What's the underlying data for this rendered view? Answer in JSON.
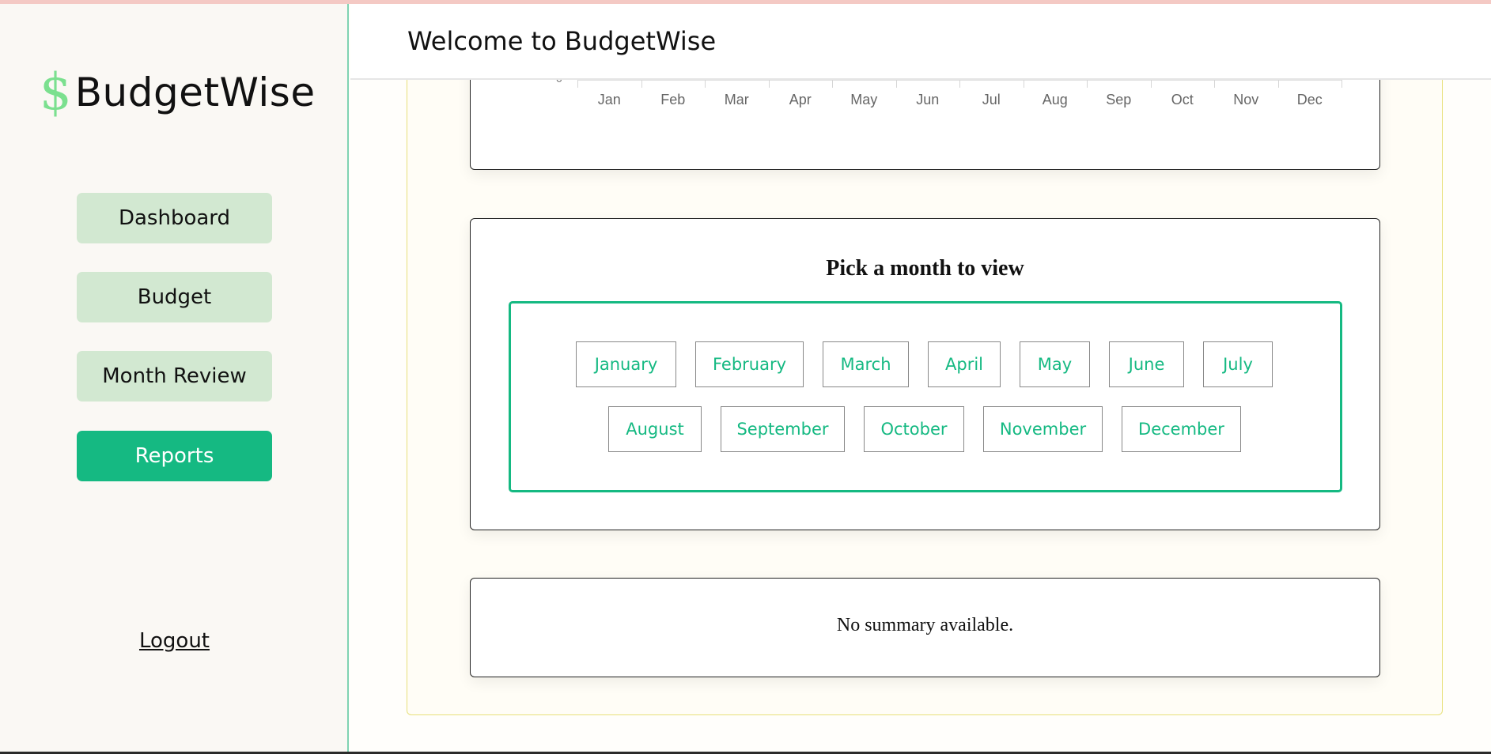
{
  "app": {
    "brand": "BudgetWise",
    "logo_icon": "dollar-sign-icon",
    "accent_color": "#15b982",
    "nav_inactive_color": "#d2e8d1"
  },
  "header": {
    "title": "Welcome to BudgetWise"
  },
  "sidebar": {
    "items": [
      {
        "label": "Dashboard",
        "active": false
      },
      {
        "label": "Budget",
        "active": false
      },
      {
        "label": "Month Review",
        "active": false
      },
      {
        "label": "Reports",
        "active": true
      }
    ],
    "logout_label": "Logout"
  },
  "chart_data": {
    "type": "bar",
    "categories": [
      "Jan",
      "Feb",
      "Mar",
      "Apr",
      "May",
      "Jun",
      "Jul",
      "Aug",
      "Sep",
      "Oct",
      "Nov",
      "Dec"
    ],
    "y_tick_visible": "0"
  },
  "month_picker": {
    "title": "Pick a month to view",
    "months": [
      "January",
      "February",
      "March",
      "April",
      "May",
      "June",
      "July",
      "August",
      "September",
      "October",
      "November",
      "December"
    ]
  },
  "summary": {
    "text": "No summary available."
  }
}
